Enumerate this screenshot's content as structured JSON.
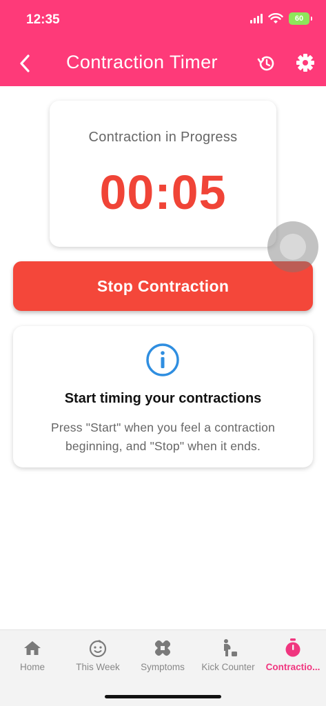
{
  "status_bar": {
    "time": "12:35",
    "battery": "60"
  },
  "header": {
    "title": "Contraction Timer"
  },
  "timer": {
    "label": "Contraction in Progress",
    "value": "00:05",
    "color": "#f04437"
  },
  "stop_button": {
    "label": "Stop Contraction",
    "color": "#f4473a"
  },
  "info": {
    "title": "Start timing your contractions",
    "description": "Press \"Start\" when you feel a contraction beginning, and \"Stop\" when it ends."
  },
  "nav": {
    "items": [
      {
        "label": "Home",
        "icon": "home-icon"
      },
      {
        "label": "This Week",
        "icon": "baby-face-icon"
      },
      {
        "label": "Symptoms",
        "icon": "bandage-icon"
      },
      {
        "label": "Kick Counter",
        "icon": "pregnant-icon"
      },
      {
        "label": "Contractio...",
        "icon": "stopwatch-icon",
        "active": true
      }
    ],
    "active_color": "#f0367f"
  },
  "colors": {
    "brand": "#fe3a79"
  }
}
